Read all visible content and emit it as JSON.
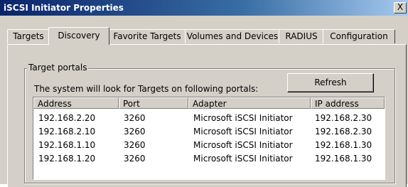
{
  "window": {
    "title": "iSCSI Initiator Properties",
    "close_glyph": "X"
  },
  "tabs": [
    {
      "label": "Targets",
      "active": false
    },
    {
      "label": "Discovery",
      "active": true
    },
    {
      "label": "Favorite Targets",
      "active": false
    },
    {
      "label": "Volumes and Devices",
      "active": false
    },
    {
      "label": "RADIUS",
      "active": false
    },
    {
      "label": "Configuration",
      "active": false
    }
  ],
  "target_portals": {
    "group_label": "Target portals",
    "description": "The system will look for Targets on following portals:",
    "refresh_label": "Refresh",
    "columns": [
      "Address",
      "Port",
      "Adapter",
      "IP address"
    ],
    "rows": [
      [
        "192.168.2.20",
        "3260",
        "Microsoft iSCSI Initiator",
        "192.168.2.30"
      ],
      [
        "192.168.2.10",
        "3260",
        "Microsoft iSCSI Initiator",
        "192.168.2.30"
      ],
      [
        "192.168.1.10",
        "3260",
        "Microsoft iSCSI Initiator",
        "192.168.1.30"
      ],
      [
        "192.168.1.20",
        "3260",
        "Microsoft iSCSI Initiator",
        "192.168.1.30"
      ]
    ]
  }
}
